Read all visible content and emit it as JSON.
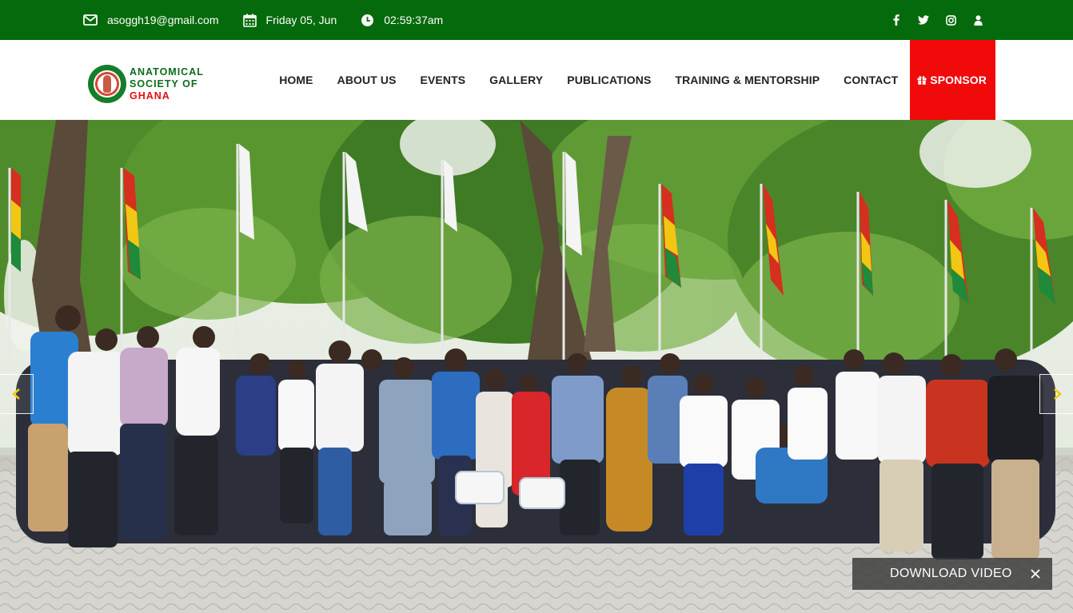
{
  "topbar": {
    "email": "asoggh19@gmail.com",
    "date": "Friday 05, Jun",
    "time": "02:59:37am",
    "social_icons": [
      "facebook-icon",
      "twitter-icon",
      "instagram-icon",
      "user-icon"
    ]
  },
  "logo": {
    "line1": "ANATOMICAL",
    "line2": "SOCIETY OF",
    "line3": "GHANA"
  },
  "nav": {
    "items": [
      "HOME",
      "ABOUT US",
      "EVENTS",
      "GALLERY",
      "PUBLICATIONS",
      "TRAINING & MENTORSHIP",
      "CONTACT"
    ],
    "sponsor": "SPONSOR"
  },
  "hero": {
    "download_label": "DOWNLOAD VIDEO"
  },
  "colors": {
    "topbar": "#056a0b",
    "sponsor": "#f00a0a",
    "logo_green": "#0d6b1d",
    "logo_red": "#e01010"
  }
}
